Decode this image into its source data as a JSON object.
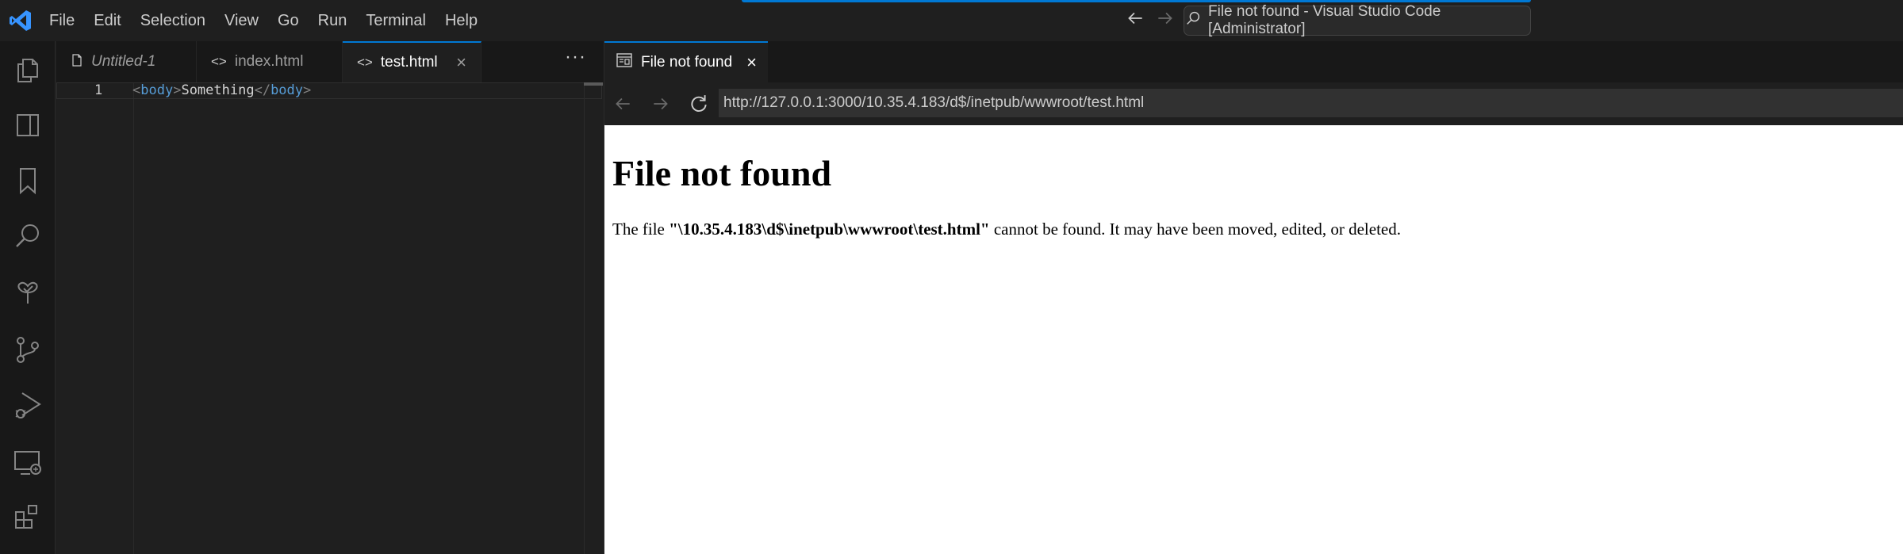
{
  "menu": [
    "File",
    "Edit",
    "Selection",
    "View",
    "Go",
    "Run",
    "Terminal",
    "Help"
  ],
  "window_title": "File not found - Visual Studio Code [Administrator]",
  "activity_bar": [
    "explorer-icon",
    "split-panel-icon",
    "bookmark-icon",
    "search-icon",
    "test-tree-icon",
    "source-control-icon",
    "run-debug-icon",
    "remote-explorer-icon",
    "extensions-icon"
  ],
  "editor": {
    "tabs": [
      {
        "label": "Untitled-1",
        "icon": "file-icon"
      },
      {
        "label": "index.html",
        "icon": "<>"
      },
      {
        "label": "test.html",
        "icon": "<>",
        "close": "×",
        "active": true
      }
    ],
    "more": "···",
    "line_number": "1",
    "code": {
      "open_bracket": "<",
      "tag": "body",
      "close_bracket": ">",
      "text": "Something",
      "end_open": "</",
      "end_tag": "body",
      "end_close": ">"
    }
  },
  "browser": {
    "tab_label": "File not found",
    "tab_close": "×",
    "url": "http://127.0.0.1:3000/10.35.4.183/d$/inetpub/wwwroot/test.html",
    "page": {
      "heading": "File not found",
      "text_prefix": "The file ",
      "path": "\"\\10.35.4.183\\d$\\inetpub\\wwwroot\\test.html\"",
      "text_suffix": " cannot be found. It may have been moved, edited, or deleted."
    }
  },
  "colors": {
    "accent": "#0078d4",
    "tag": "#569cd6",
    "logo": "#3794ff"
  }
}
